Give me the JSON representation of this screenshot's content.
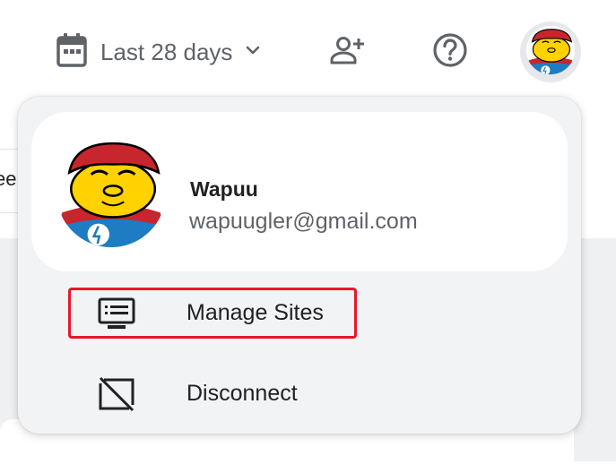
{
  "background": {
    "left_fragment_text": "ee"
  },
  "header": {
    "date_range": {
      "icon": "calendar-icon",
      "label": "Last 28 days",
      "dropdown_icon": "chevron-down-icon"
    },
    "add_user_icon": "person-add-icon",
    "help_icon": "help-circle-icon",
    "account_avatar": "wapuu-avatar"
  },
  "account_menu": {
    "user": {
      "name": "Wapuu",
      "email": "wapuugler@gmail.com",
      "avatar": "wapuu-avatar"
    },
    "items": [
      {
        "label": "Manage Sites",
        "icon": "list-window-icon",
        "highlighted": true
      },
      {
        "label": "Disconnect",
        "icon": "screen-off-icon",
        "highlighted": false
      }
    ]
  },
  "colors": {
    "highlight_border": "#e8162b",
    "menu_background": "#f1f3f4",
    "icon_gray": "#5f6368",
    "wapuu_yellow": "#ffd200",
    "wapuu_red": "#c8262f",
    "wapuu_blue": "#1d7cc2"
  }
}
